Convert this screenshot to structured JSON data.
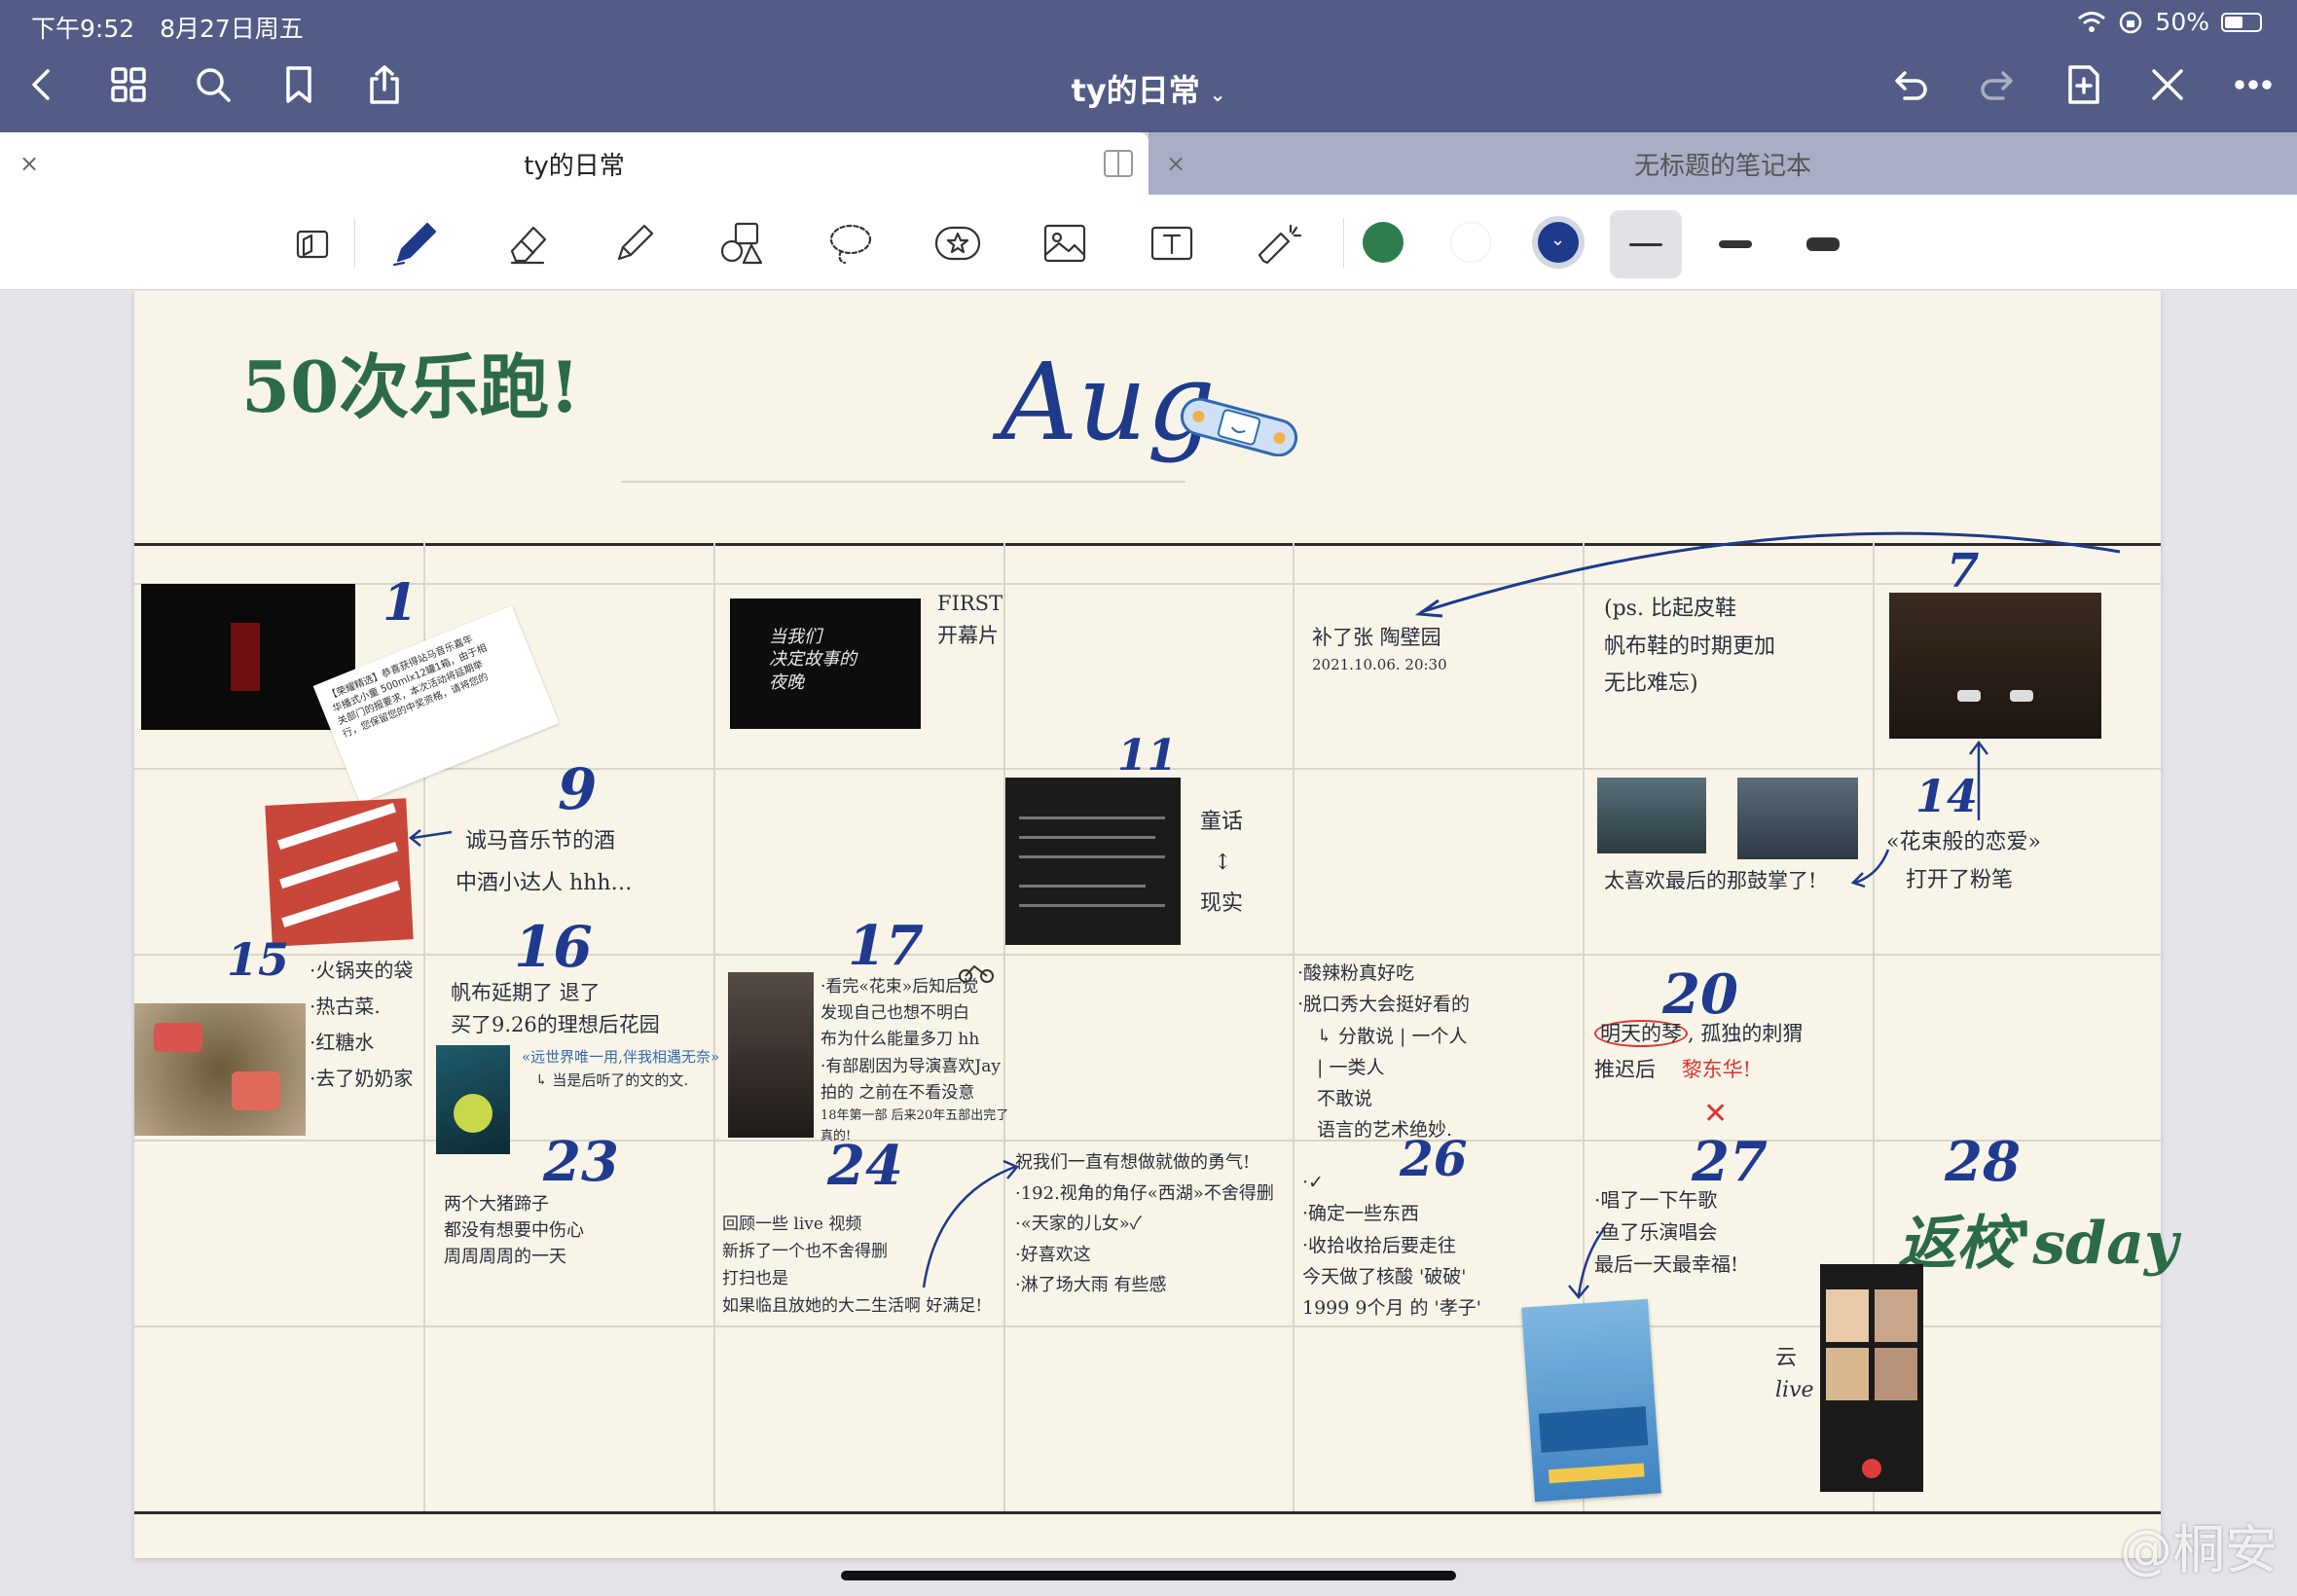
{
  "status_bar": {
    "time": "下午9:52",
    "date": "8月27日周五",
    "battery": "50%"
  },
  "nav": {
    "title": "ty的日常"
  },
  "tabs": [
    {
      "label": "ty的日常",
      "active": true
    },
    {
      "label": "无标题的笔记本",
      "active": false
    }
  ],
  "toolbar": {
    "colors": [
      "#2e7d4f",
      "#ffffff",
      "#1e3a8a"
    ],
    "selected_color": "#1e3a8a"
  },
  "page": {
    "header_left": "50次乐跑!",
    "month": "Aug.",
    "cells": {
      "d1": {
        "day": "1"
      },
      "d1_paper": {
        "lines": [
          "【荣耀精选】恭喜获得站马音乐嘉年",
          "华播式小童 500mlx12罐1箱，由于相",
          "关部门的报要求，本次活动将延期举",
          "行，您保留您的中奖资格，请将您的"
        ]
      },
      "first": {
        "lines": [
          "FIRST",
          "开幕片"
        ]
      },
      "film_poster": {
        "lines": [
          "当我们",
          "决定故事的",
          "夜晚"
        ]
      },
      "d_makeup": {
        "lines": [
          "补了张  陶壁园",
          "2021.10.06. 20:30"
        ]
      },
      "d_ps": {
        "lines": [
          "(ps. 比起皮鞋",
          "帆布鞋的时期更加",
          "无比难忘)"
        ]
      },
      "d7": {
        "day": "7"
      },
      "d9": {
        "day": "9",
        "lines": [
          "诚马音乐节的酒",
          "中酒小达人 hhh…"
        ]
      },
      "d11": {
        "day": "11",
        "lines": [
          "童话",
          "↕",
          "现实"
        ]
      },
      "d13": {
        "lines": [
          "太喜欢最后的那鼓掌了!"
        ]
      },
      "d14": {
        "day": "14",
        "lines": [
          "«花束般的恋爱»",
          "打开了粉笔"
        ]
      },
      "d15": {
        "day": "15",
        "lines": [
          "·火锅夹的袋",
          "·热古菜.",
          "·红糖水",
          "·去了奶奶家"
        ]
      },
      "d16": {
        "day": "16",
        "lines": [
          "帆布延期了 退了",
          "买了9.26的理想后花园",
          "«远世界唯一用,伴我相遇无奈»",
          "↳ 当是后听了的文的文."
        ]
      },
      "d17": {
        "day": "17",
        "lines": [
          "·看完«花束»后知后觉",
          "发现自己也想不明白",
          "布为什么能量多刀 hh",
          "·有部剧因为导演喜欢Jay",
          "拍的 之前在不看没意",
          "18年第一部  后来20年五部出完了",
          "真的!"
        ]
      },
      "d18": {
        "lines": [
          "·酸辣粉真好吃",
          "·脱口秀大会挺好看的",
          "↳ 分散说 | 一个人",
          "        | 一类人",
          "  不敢说",
          "  语言的艺术绝妙."
        ]
      },
      "d20": {
        "day": "20",
        "lines": [
          "明天的琴",
          "孤独的刺猬",
          "推迟后",
          "黎东华!"
        ]
      },
      "d23": {
        "day": "23",
        "lines": [
          "两个大猪蹄子",
          "都没有想要中伤心",
          "周周周周的一天"
        ]
      },
      "d24": {
        "day": "24",
        "lines": [
          "回顾一些 live 视频",
          "新拆了一个也不舍得删",
          "打扫也是",
          "如果临且放她的大二生活啊  好满足!"
        ]
      },
      "d25": {
        "lines": [
          "祝我们一直有想做就做的勇气!",
          "·192.视角的角仔«西湖»不舍得删",
          "·«天家的儿女»✓",
          "·好喜欢这",
          "·淋了场大雨  有些感"
        ]
      },
      "d26": {
        "day": "26",
        "lines": [
          "·✓",
          "·确定一些东西",
          "·收拾收拾后要走往",
          "今天做了核酸 '破破'",
          "1999 9个月 的 '孝子'"
        ]
      },
      "d27": {
        "day": "27",
        "lines": [
          "·唱了一下午歌",
          "·鱼了乐演唱会",
          "最后一天最幸福!"
        ]
      },
      "d28": {
        "day": "28",
        "lines": [
          "返校'sday"
        ]
      },
      "cloud_live": {
        "lines": [
          "云",
          "live"
        ]
      }
    }
  },
  "watermark": "@桐安"
}
